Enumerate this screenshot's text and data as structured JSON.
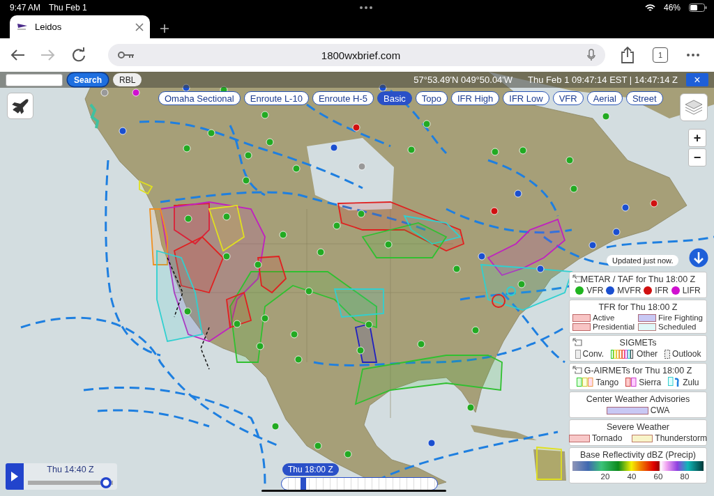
{
  "status_bar": {
    "time": "9:47 AM",
    "date": "Thu Feb 1",
    "battery": "46%"
  },
  "browser": {
    "tab": {
      "title": "Leidos"
    },
    "address": "1800wxbrief.com",
    "tab_count": "1"
  },
  "map_header": {
    "search_button": "Search",
    "rbl_button": "RBL",
    "coordinates": "57°53.49'N 049°50.04'W",
    "datetime": "Thu Feb 1 09:47:14 EST | 14:47:14 Z",
    "close": "×"
  },
  "layers": [
    {
      "label": "Omaha Sectional",
      "selected": false
    },
    {
      "label": "Enroute L-10",
      "selected": false
    },
    {
      "label": "Enroute H-5",
      "selected": false
    },
    {
      "label": "Basic",
      "selected": true
    },
    {
      "label": "Topo",
      "selected": false
    },
    {
      "label": "IFR High",
      "selected": false
    },
    {
      "label": "IFR Low",
      "selected": false
    },
    {
      "label": "VFR",
      "selected": false
    },
    {
      "label": "Aerial",
      "selected": false
    },
    {
      "label": "Street",
      "selected": false
    }
  ],
  "zoom": [
    "+",
    "−"
  ],
  "update_notice": "Updated just now.",
  "legend": [
    {
      "kind": "dots",
      "title": "METAR / TAF for Thu 18:00 Z",
      "collapsible": true,
      "items": [
        {
          "label": "VFR",
          "color": "#1fb41f"
        },
        {
          "label": "MVFR",
          "color": "#1a4fd0"
        },
        {
          "label": "IFR",
          "color": "#d01010"
        },
        {
          "label": "LIFR",
          "color": "#d010d0"
        }
      ]
    },
    {
      "kind": "grid",
      "title": "TFR for Thu 18:00 Z",
      "collapsible": false,
      "items": [
        {
          "label": "Active",
          "color": "#f8c4c4"
        },
        {
          "label": "Fire Fighting",
          "color": "#c8c8f4"
        },
        {
          "label": "Presidential",
          "color": "#f8c4c4"
        },
        {
          "label": "Scheduled",
          "color": "#e0f8f8"
        }
      ]
    },
    {
      "kind": "icons",
      "title": "SIGMETs",
      "collapsible": true,
      "items": [
        {
          "label": "Conv.",
          "kind": "plain"
        },
        {
          "label": "Other",
          "kind": "rainbow"
        },
        {
          "label": "Outlook",
          "kind": "dashed"
        }
      ]
    },
    {
      "kind": "icons",
      "title": "G-AIRMETs for Thu 18:00 Z",
      "collapsible": true,
      "items": [
        {
          "label": "Tango",
          "kind": "tango"
        },
        {
          "label": "Sierra",
          "kind": "sierra"
        },
        {
          "label": "Zulu",
          "kind": "zulu"
        }
      ]
    },
    {
      "kind": "swatches",
      "title": "Center Weather Advisories",
      "collapsible": false,
      "items": [
        {
          "label": "CWA",
          "color": "#c8c8f4",
          "wide": true
        }
      ]
    },
    {
      "kind": "swatches",
      "title": "Severe Weather",
      "collapsible": false,
      "items": [
        {
          "label": "Tornado",
          "color": "#f8c8c8",
          "wide": false
        },
        {
          "label": "Thunderstorm",
          "color": "#f8f4c8",
          "wide": false
        }
      ]
    },
    {
      "kind": "scale",
      "title": "Base Reflectivity dBZ (Precip)",
      "collapsible": false,
      "ticks": [
        "20",
        "40",
        "60",
        "80"
      ]
    }
  ],
  "playback": {
    "time": "Thu 14:40 Z",
    "level": 0.92
  },
  "forecast_timeline": {
    "label": "Thu 18:00 Z",
    "level": 0.14
  }
}
